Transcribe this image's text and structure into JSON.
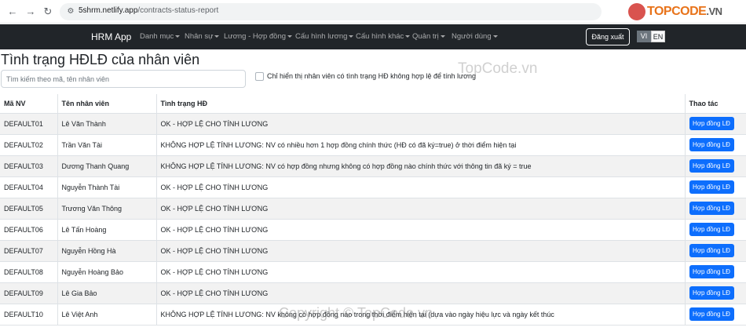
{
  "browser": {
    "url_host": "5shrm.netlify.app",
    "url_path": "/contracts-status-report",
    "back_icon": "arrow-left-icon",
    "forward_icon": "arrow-right-icon",
    "reload_icon": "reload-icon"
  },
  "watermark": {
    "logo_text": "TOPCODE",
    "logo_suffix": ".VN",
    "mid_text": "TopCode.vn",
    "bottom_text": "Copyright © TopCode.vn"
  },
  "navbar": {
    "brand": "HRM App",
    "menu": [
      "Danh mục",
      "Nhân sự",
      "Lương - Hợp đồng",
      "Cấu hình lương",
      "Cấu hình khác",
      "Quản trị",
      "Người dùng"
    ],
    "logout_label": "Đăng xuất",
    "lang_vi": "VI",
    "lang_en": "EN"
  },
  "page": {
    "title": "Tình trạng HĐLĐ của nhân viên",
    "search_placeholder": "Tìm kiếm theo mã, tên nhân viên",
    "filter_label": "Chỉ hiển thị nhân viên có tình trạng HĐ không hợp lệ để tính lương"
  },
  "table": {
    "headers": [
      "Mã NV",
      "Tên nhân viên",
      "Tình trạng HĐ",
      "Thao tác"
    ],
    "action_label": "Hợp đồng LĐ",
    "rows": [
      {
        "id": "DEFAULT01",
        "name": "Lê Văn Thành",
        "status": "OK - HỢP LỆ CHO TÍNH LƯƠNG"
      },
      {
        "id": "DEFAULT02",
        "name": "Trần Văn Tài",
        "status": "KHÔNG HỢP LỆ TÍNH LƯƠNG: NV có nhiều hơn 1 hợp đồng chính thức (HĐ có đã ký=true) ở thời điểm hiện tại"
      },
      {
        "id": "DEFAULT03",
        "name": "Dương Thanh Quang",
        "status": "KHÔNG HỢP LỆ TÍNH LƯƠNG: NV có hợp đồng nhưng không có hợp đồng nào chính thức với thông tin đã ký = true"
      },
      {
        "id": "DEFAULT04",
        "name": "Nguyễn Thành Tài",
        "status": "OK - HỢP LỆ CHO TÍNH LƯƠNG"
      },
      {
        "id": "DEFAULT05",
        "name": "Trương Văn Thông",
        "status": "OK - HỢP LỆ CHO TÍNH LƯƠNG"
      },
      {
        "id": "DEFAULT06",
        "name": "Lê Tấn Hoàng",
        "status": "OK - HỢP LỆ CHO TÍNH LƯƠNG"
      },
      {
        "id": "DEFAULT07",
        "name": "Nguyễn Hồng Hà",
        "status": "OK - HỢP LỆ CHO TÍNH LƯƠNG"
      },
      {
        "id": "DEFAULT08",
        "name": "Nguyễn Hoàng Bảo",
        "status": "OK - HỢP LỆ CHO TÍNH LƯƠNG"
      },
      {
        "id": "DEFAULT09",
        "name": "Lê Gia Bảo",
        "status": "OK - HỢP LỆ CHO TÍNH LƯƠNG"
      },
      {
        "id": "DEFAULT10",
        "name": "Lê Việt Anh",
        "status": "KHÔNG HỢP LỆ TÍNH LƯƠNG: NV không có hợp đồng nào trong thời điểm hiện tại (dựa vào ngày hiệu lực và ngày kết thúc"
      }
    ]
  }
}
